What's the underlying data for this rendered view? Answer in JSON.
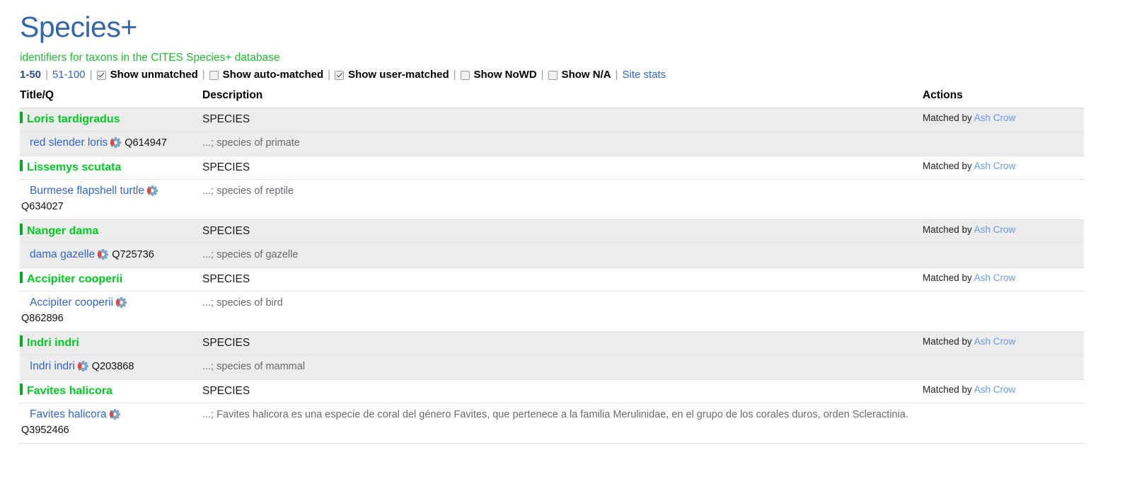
{
  "header": {
    "title": "Species+",
    "subtitle": "identifiers for taxons in the CITES Species+ database"
  },
  "filterbar": {
    "pager_current": "1-50",
    "pager_next": "51-100",
    "separator": "|",
    "options": [
      {
        "label": "Show unmatched",
        "checked": true,
        "name": "show-unmatched"
      },
      {
        "label": "Show auto-matched",
        "checked": false,
        "name": "show-auto-matched"
      },
      {
        "label": "Show user-matched",
        "checked": true,
        "name": "show-user-matched"
      },
      {
        "label": "Show NoWD",
        "checked": false,
        "name": "show-nowd"
      },
      {
        "label": "Show N/A",
        "checked": false,
        "name": "show-na"
      }
    ],
    "site_stats": "Site stats"
  },
  "table": {
    "columns": {
      "title": "Title/Q",
      "description": "Description",
      "actions": "Actions"
    },
    "matched_prefix": "Matched by",
    "rows": [
      {
        "taxon": "Loris tardigradus",
        "type": "SPECIES",
        "matched_by": "Ash Crow",
        "item_label": "red slender loris",
        "qid": "Q614947",
        "item_desc": "...; species of primate",
        "qid_wraps": false
      },
      {
        "taxon": "Lissemys scutata",
        "type": "SPECIES",
        "matched_by": "Ash Crow",
        "item_label": "Burmese flapshell turtle",
        "qid": "Q634027",
        "item_desc": "...; species of reptile",
        "qid_wraps": true
      },
      {
        "taxon": "Nanger dama",
        "type": "SPECIES",
        "matched_by": "Ash Crow",
        "item_label": "dama gazelle",
        "qid": "Q725736",
        "item_desc": "...; species of gazelle",
        "qid_wraps": false
      },
      {
        "taxon": "Accipiter cooperii",
        "type": "SPECIES",
        "matched_by": "Ash Crow",
        "item_label": "Accipiter cooperii",
        "qid": "Q862896",
        "item_desc": "...; species of bird",
        "qid_wraps": true
      },
      {
        "taxon": "Indri indri",
        "type": "SPECIES",
        "matched_by": "Ash Crow",
        "item_label": "Indri indri",
        "qid": "Q203868",
        "item_desc": "...; species of mammal",
        "qid_wraps": false
      },
      {
        "taxon": "Favites halicora",
        "type": "SPECIES",
        "matched_by": "Ash Crow",
        "item_label": "Favites halicora",
        "qid": "Q3952466",
        "item_desc": "...; Favites halicora es una especie de coral del género Favites, que pertenece a la familia Merulinidae, en el grupo de los corales duros, orden Scleractinia.",
        "qid_wraps": true
      }
    ]
  },
  "icons": {
    "cog": "cog-icon"
  },
  "colors": {
    "title_blue": "#3366aa",
    "subtitle_green": "#22bb33",
    "taxon_green": "#00cc22",
    "link_blue": "#3366cc",
    "alt_row": "#ececec"
  }
}
